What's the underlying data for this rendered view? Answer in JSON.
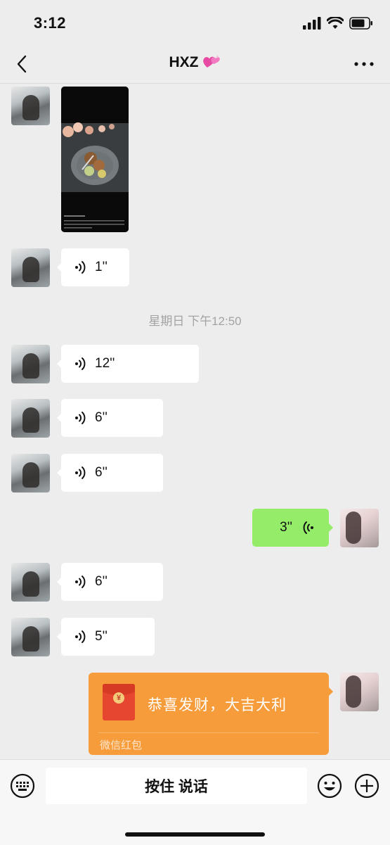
{
  "status_bar": {
    "time": "3:12"
  },
  "nav": {
    "title": "HXZ"
  },
  "messages": {
    "voice_1": "1''",
    "timestamp": "星期日 下午12:50",
    "voice_2": "12''",
    "voice_3": "6''",
    "voice_4": "6''",
    "voice_me_1": "3''",
    "voice_5": "6''",
    "voice_6": "5''"
  },
  "red_packet": {
    "greeting": "恭喜发财，大吉大利",
    "label": "微信红包",
    "coin_symbol": "¥"
  },
  "input_bar": {
    "hold_to_talk": "按住 说话"
  },
  "colors": {
    "background": "#ededed",
    "my_bubble": "#95ec69",
    "red_packet": "#f79c3b"
  },
  "icons": [
    "back-chevron",
    "heart-emoji",
    "more-dots",
    "voice-wave",
    "keyboard",
    "emoji-smile",
    "plus-circle"
  ]
}
